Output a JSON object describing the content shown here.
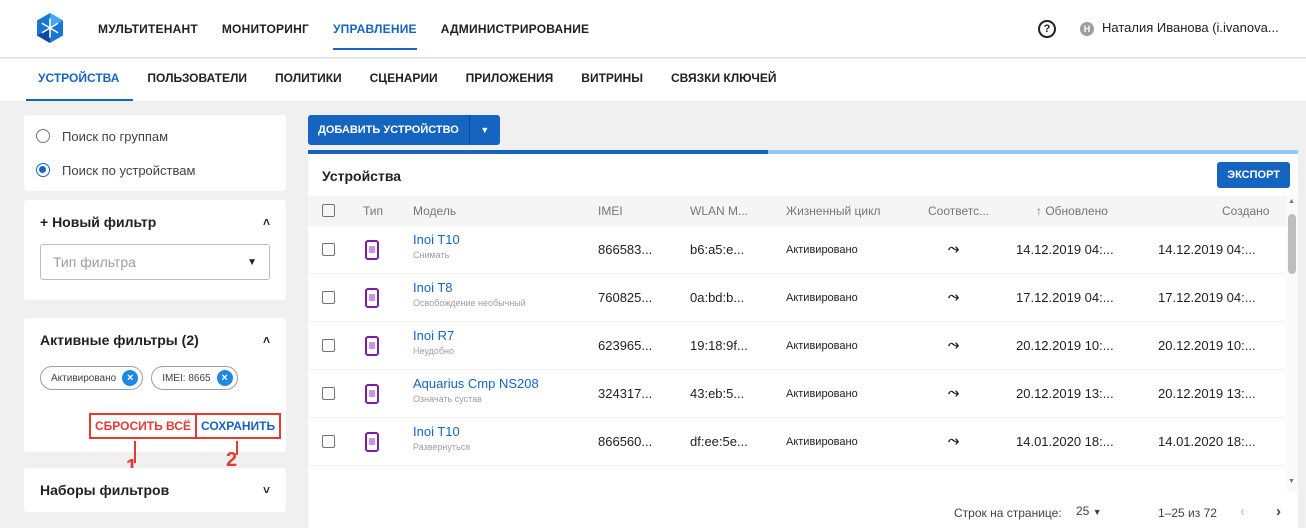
{
  "topnav": {
    "items": [
      "МУЛЬТИТЕНАНТ",
      "МОНИТОРИНГ",
      "УПРАВЛЕНИЕ",
      "АДМИНИСТРИРОВАНИЕ"
    ],
    "active": "УПРАВЛЕНИЕ",
    "help": "?",
    "avatar_letter": "Н",
    "user": "Наталия Иванова (i.ivanova..."
  },
  "subnav": {
    "items": [
      "УСТРОЙСТВА",
      "ПОЛЬЗОВАТЕЛИ",
      "ПОЛИТИКИ",
      "СЦЕНАРИИ",
      "ПРИЛОЖЕНИЯ",
      "ВИТРИНЫ",
      "СВЯЗКИ КЛЮЧЕЙ"
    ],
    "active": "УСТРОЙСТВА"
  },
  "search": {
    "by_groups": "Поиск по группам",
    "by_devices": "Поиск по устройствам",
    "selected": "Поиск по устройствам"
  },
  "new_filter": {
    "title": "+ Новый фильтр",
    "placeholder": "Тип фильтра"
  },
  "active_filters": {
    "title": "Активные фильтры (2)",
    "chips": [
      "Активировано",
      "IMEI: 8665"
    ],
    "reset": "СБРОСИТЬ ВСЁ",
    "save": "СОХРАНИТЬ",
    "marker_reset": "1",
    "marker_save": "2"
  },
  "filter_sets": {
    "title": "Наборы фильтров"
  },
  "toolbar": {
    "add_device": "ДОБАВИТЬ УСТРОЙСТВО",
    "export": "ЭКСПОРТ",
    "loading_progress": 0.465
  },
  "table": {
    "title": "Устройства",
    "headers": {
      "type": "Тип",
      "model": "Модель",
      "imei": "IMEI",
      "wlan": "WLAN M...",
      "lifecycle": "Жизненный цикл",
      "compliance": "Соответс...",
      "updated": "↑ Обновлено",
      "created": "Создано"
    },
    "rows": [
      {
        "model": "Inoi T10",
        "sub": "Снимать",
        "imei": "866583...",
        "wlan": "b6:a5:e...",
        "lifecycle": "Активировано",
        "updated": "14.12.2019 04:...",
        "created": "14.12.2019 04:..."
      },
      {
        "model": "Inoi T8",
        "sub": "Освобождение необычный",
        "imei": "760825...",
        "wlan": "0a:bd:b...",
        "lifecycle": "Активировано",
        "updated": "17.12.2019 04:...",
        "created": "17.12.2019 04:..."
      },
      {
        "model": "Inoi R7",
        "sub": "Неудобно",
        "imei": "623965...",
        "wlan": "19:18:9f...",
        "lifecycle": "Активировано",
        "updated": "20.12.2019 10:...",
        "created": "20.12.2019 10:..."
      },
      {
        "model": "Aquarius Cmp NS208",
        "sub": "Означать сустав",
        "imei": "324317...",
        "wlan": "43:eb:5...",
        "lifecycle": "Активировано",
        "updated": "20.12.2019 13:...",
        "created": "20.12.2019 13:..."
      },
      {
        "model": "Inoi T10",
        "sub": "Развернуться",
        "imei": "866560...",
        "wlan": "df:ee:5e...",
        "lifecycle": "Активировано",
        "updated": "14.01.2020 18:...",
        "created": "14.01.2020 18:..."
      }
    ]
  },
  "pagination": {
    "rows_per_page_label": "Строк на странице:",
    "rows_per_page": "25",
    "range": "1–25 из 72"
  },
  "colors": {
    "accent": "#1565c0",
    "annotation": "#e53935",
    "device_icon": "#7b1fa2"
  }
}
